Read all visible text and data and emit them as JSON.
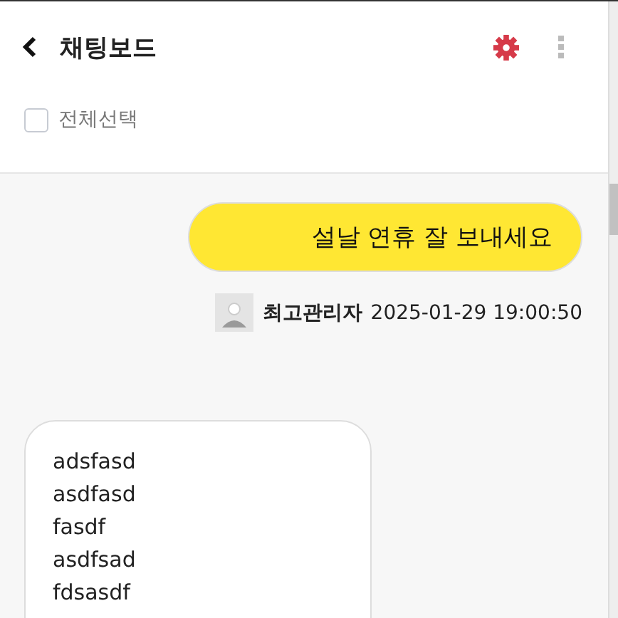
{
  "header": {
    "title": "채팅보드"
  },
  "select_all": {
    "label": "전체선택",
    "checked": false
  },
  "messages": [
    {
      "kind": "sent",
      "text": "설날 연휴 잘 보내세요",
      "author": "최고관리자",
      "time": "2025-01-29 19:00:50"
    },
    {
      "kind": "received",
      "lines": [
        "adsfasd",
        "asdfasd",
        "fasdf",
        "asdfsad",
        "fdsasdf"
      ]
    }
  ]
}
